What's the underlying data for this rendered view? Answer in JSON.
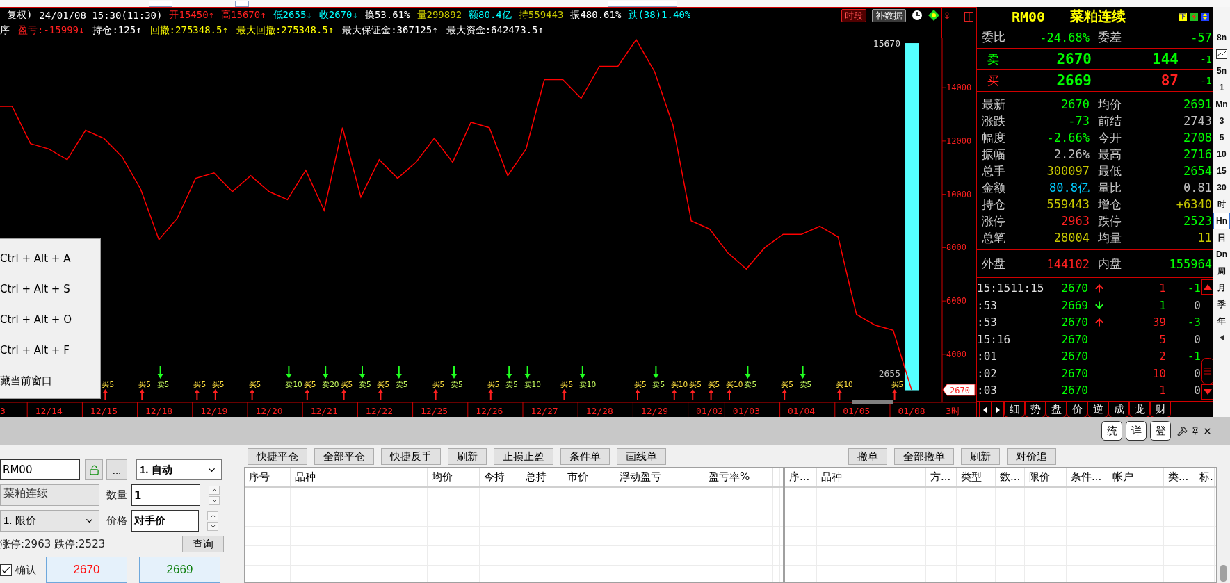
{
  "chart_header": {
    "line1": [
      {
        "text": "复权)",
        "color": "#ffffff"
      },
      {
        "text": "24/01/08 15:30(11:30)",
        "color": "#ffffff"
      },
      {
        "text": "开15450↑",
        "color": "#ff2020"
      },
      {
        "text": "高15670↑",
        "color": "#ff2020"
      },
      {
        "text": "低2655↓",
        "color": "#00ffff"
      },
      {
        "text": "收2670↓",
        "color": "#00ffff"
      },
      {
        "text": "换53.61%",
        "color": "#ffffff"
      },
      {
        "text": "量299892",
        "color": "#c8c800"
      },
      {
        "text": "额80.4亿",
        "color": "#00ffff"
      },
      {
        "text": "持559443",
        "color": "#c8c800"
      },
      {
        "text": "振480.61%",
        "color": "#ffffff"
      },
      {
        "text": "跌(38)1.40%",
        "color": "#00ffff"
      }
    ],
    "line2": [
      {
        "text": "序",
        "color": "#ffffff"
      },
      {
        "text": "盈亏:-15999↓",
        "color": "#ff2020"
      },
      {
        "text": "持仓:125↑",
        "color": "#ffffff"
      },
      {
        "text": "回撤:275348.5↑",
        "color": "#ffff00"
      },
      {
        "text": "最大回撤:275348.5↑",
        "color": "#ffff00"
      },
      {
        "text": "最大保证金:367125↑",
        "color": "#ffffff"
      },
      {
        "text": "最大资金:642473.5↑",
        "color": "#ffffff"
      }
    ],
    "buttons": [
      {
        "label": "时段",
        "kind": "alert"
      },
      {
        "label": "补数据",
        "kind": "plain"
      }
    ]
  },
  "chart": {
    "edge_label": "3",
    "period_label": "3时",
    "candle": {
      "high_label": "15670",
      "low_label": "2655"
    },
    "price_tag": "2670",
    "signals": [
      {
        "kind": "none"
      },
      {
        "kind": "none"
      },
      {
        "kind": "none"
      },
      {
        "kind": "none"
      },
      {
        "kind": "none"
      },
      {
        "kind": "none"
      },
      {
        "kind": "buy",
        "label": "买5"
      },
      {
        "kind": "none"
      },
      {
        "kind": "buy",
        "label": "买5"
      },
      {
        "kind": "sell",
        "label": "卖5"
      },
      {
        "kind": "none"
      },
      {
        "kind": "buy",
        "label": "买5"
      },
      {
        "kind": "buy",
        "label": "买5"
      },
      {
        "kind": "none"
      },
      {
        "kind": "buy",
        "label": "买5"
      },
      {
        "kind": "none"
      },
      {
        "kind": "sell",
        "label": "卖10"
      },
      {
        "kind": "buy",
        "label": "买5"
      },
      {
        "kind": "sell",
        "label": "卖20"
      },
      {
        "kind": "buy",
        "label": "买5"
      },
      {
        "kind": "sell",
        "label": "卖5"
      },
      {
        "kind": "buy",
        "label": "买5"
      },
      {
        "kind": "sell",
        "label": "卖5"
      },
      {
        "kind": "none"
      },
      {
        "kind": "buy",
        "label": "买5"
      },
      {
        "kind": "sell",
        "label": "卖5"
      },
      {
        "kind": "none"
      },
      {
        "kind": "buy",
        "label": "买5"
      },
      {
        "kind": "sell",
        "label": "卖5"
      },
      {
        "kind": "sell",
        "label": "卖10"
      },
      {
        "kind": "none"
      },
      {
        "kind": "buy",
        "label": "买5"
      },
      {
        "kind": "sell",
        "label": "卖10"
      },
      {
        "kind": "none"
      },
      {
        "kind": "none"
      },
      {
        "kind": "buy",
        "label": "买5"
      },
      {
        "kind": "sell",
        "label": "卖5"
      },
      {
        "kind": "buy",
        "label": "买10"
      },
      {
        "kind": "buy",
        "label": "买5"
      },
      {
        "kind": "buy",
        "label": "买5"
      },
      {
        "kind": "buy",
        "label": "买10"
      },
      {
        "kind": "sell",
        "label": "卖5"
      },
      {
        "kind": "none"
      },
      {
        "kind": "buy",
        "label": "买5"
      },
      {
        "kind": "sell",
        "label": "卖5"
      },
      {
        "kind": "none"
      },
      {
        "kind": "buy",
        "label": "买10"
      },
      {
        "kind": "none"
      },
      {
        "kind": "none"
      },
      {
        "kind": "buy",
        "label": "买5"
      }
    ],
    "chart_data": {
      "type": "line",
      "categories": [
        null,
        null,
        null,
        "12/14",
        null,
        null,
        "12/15",
        null,
        null,
        "12/18",
        null,
        null,
        "12/19",
        null,
        null,
        "12/20",
        null,
        null,
        "12/21",
        null,
        null,
        "12/22",
        null,
        null,
        "12/25",
        null,
        null,
        "12/26",
        null,
        null,
        "12/27",
        null,
        null,
        "12/28",
        null,
        null,
        "12/29",
        null,
        null,
        "01/02",
        null,
        "01/03",
        null,
        null,
        "01/04",
        null,
        null,
        "01/05",
        null,
        null,
        "01/08"
      ],
      "series": [
        {
          "color": "#ff0000",
          "values": [
            13300,
            13300,
            11900,
            11700,
            11300,
            12400,
            12100,
            11400,
            10200,
            8300,
            9100,
            10600,
            10800,
            10100,
            10700,
            10100,
            9800,
            10900,
            9400,
            12500,
            9900,
            11300,
            10600,
            11200,
            12100,
            11200,
            12700,
            12500,
            10700,
            11700,
            14300,
            14300,
            13600,
            14800,
            14800,
            15800,
            14600,
            12600,
            9000,
            8700,
            7800,
            7200,
            8000,
            8500,
            8500,
            8800,
            8400,
            5500,
            5100,
            4900,
            2670
          ]
        }
      ],
      "ylim": [
        2200,
        17000
      ],
      "yticks": [
        4000,
        6000,
        8000,
        10000,
        12000,
        14000
      ]
    }
  },
  "context_menu": {
    "items": [
      "Ctrl + Alt + A",
      "Ctrl + Alt + S",
      "Ctrl + Alt + O",
      "Ctrl + Alt + F",
      "藏当前窗口"
    ]
  },
  "quote": {
    "code": "RM00",
    "name": "菜粕连续",
    "badge": "下",
    "ratio": [
      {
        "label": "委比",
        "value": "-24.68%",
        "color": "#00ff00"
      },
      {
        "label": "委差",
        "value": "-57",
        "color": "#00ff00"
      }
    ],
    "book": [
      {
        "cells": [
          {
            "text": "卖",
            "color": "#00ff00"
          },
          {
            "text": "2670",
            "color": "#00ff00"
          },
          {
            "text": "144",
            "color": "#00ff00"
          },
          {
            "text": "-1",
            "color": "#00ff00"
          }
        ]
      },
      {
        "cells": [
          {
            "text": "买",
            "color": "#ff2020"
          },
          {
            "text": "2669",
            "color": "#00ff00"
          },
          {
            "text": "87",
            "color": "#ff2020"
          },
          {
            "text": "-1",
            "color": "#00ff00"
          }
        ]
      }
    ],
    "stats": [
      {
        "label": "最新",
        "value": "2670",
        "color": "#00ff00"
      },
      {
        "label": "均价",
        "value": "2691",
        "color": "#00ff00"
      },
      {
        "label": "涨跌",
        "value": "-73",
        "color": "#00ff00"
      },
      {
        "label": "前结",
        "value": "2743",
        "color": "#c0c0c0"
      },
      {
        "label": "幅度",
        "value": "-2.66%",
        "color": "#00ff00"
      },
      {
        "label": "今开",
        "value": "2708",
        "color": "#00ff00"
      },
      {
        "label": "振幅",
        "value": "2.26%",
        "color": "#c0c0c0"
      },
      {
        "label": "最高",
        "value": "2716",
        "color": "#00ff00"
      },
      {
        "label": "总手",
        "value": "300097",
        "color": "#c8c800"
      },
      {
        "label": "最低",
        "value": "2654",
        "color": "#00ff00"
      },
      {
        "label": "金额",
        "value": "80.8亿",
        "color": "#00ccff"
      },
      {
        "label": "量比",
        "value": "0.81",
        "color": "#c0c0c0"
      },
      {
        "label": "持仓",
        "value": "559443",
        "color": "#c8c800"
      },
      {
        "label": "增仓",
        "value": "+6340",
        "color": "#c8c800"
      },
      {
        "label": "涨停",
        "value": "2963",
        "color": "#ff2020"
      },
      {
        "label": "跌停",
        "value": "2523",
        "color": "#00ff00"
      },
      {
        "label": "总笔",
        "value": "28004",
        "color": "#c8c800"
      },
      {
        "label": "均量",
        "value": "11",
        "color": "#c8c800"
      }
    ],
    "flow": [
      {
        "label": "外盘",
        "value": "144102",
        "color": "#ff2020"
      },
      {
        "label": "内盘",
        "value": "155964",
        "color": "#00ff00"
      }
    ],
    "ticks": [
      {
        "time": "15:1511:15",
        "price": "2670",
        "kind": "up",
        "volume": {
          "text": "1",
          "color": "#ff2020"
        },
        "change": {
          "text": "-1",
          "color": "#00ff00"
        },
        "divider": false
      },
      {
        "time": ":53",
        "price": "2669",
        "kind": "down",
        "volume": {
          "text": "1",
          "color": "#00ff00"
        },
        "change": {
          "text": "0",
          "color": "#c0c0c0"
        },
        "divider": false
      },
      {
        "time": ":53",
        "price": "2670",
        "kind": "up",
        "volume": {
          "text": "39",
          "color": "#ff2020"
        },
        "change": {
          "text": "-3",
          "color": "#00ff00"
        },
        "divider": false
      },
      {
        "time": "15:16",
        "price": "2670",
        "kind": "none",
        "volume": {
          "text": "5",
          "color": "#ff2020"
        },
        "change": {
          "text": "0",
          "color": "#c0c0c0"
        },
        "divider": true
      },
      {
        "time": ":01",
        "price": "2670",
        "kind": "none",
        "volume": {
          "text": "2",
          "color": "#ff2020"
        },
        "change": {
          "text": "-1",
          "color": "#00ff00"
        },
        "divider": false
      },
      {
        "time": ":02",
        "price": "2670",
        "kind": "none",
        "volume": {
          "text": "10",
          "color": "#ff2020"
        },
        "change": {
          "text": "0",
          "color": "#c0c0c0"
        },
        "divider": false
      },
      {
        "time": ":03",
        "price": "2670",
        "kind": "none",
        "volume": {
          "text": "1",
          "color": "#ff2020"
        },
        "change": {
          "text": "0",
          "color": "#c0c0c0"
        },
        "divider": false
      }
    ],
    "tabs": [
      "细",
      "势",
      "盘",
      "价",
      "逆",
      "成",
      "龙",
      "财"
    ]
  },
  "periods": [
    {
      "kind": "text",
      "label": "8n",
      "selected": false
    },
    {
      "kind": "icon",
      "selected": false
    },
    {
      "kind": "text",
      "label": "5n",
      "selected": false
    },
    {
      "kind": "text",
      "label": "1",
      "selected": false
    },
    {
      "kind": "text",
      "label": "Mn",
      "selected": false
    },
    {
      "kind": "text",
      "label": "3",
      "selected": false
    },
    {
      "kind": "text",
      "label": "5",
      "selected": false
    },
    {
      "kind": "text",
      "label": "10",
      "selected": false
    },
    {
      "kind": "text",
      "label": "15",
      "selected": false
    },
    {
      "kind": "text",
      "label": "30",
      "selected": false
    },
    {
      "kind": "text",
      "label": "时",
      "selected": false
    },
    {
      "kind": "text",
      "label": "Hn",
      "selected": true
    },
    {
      "kind": "text",
      "label": "日",
      "selected": false
    },
    {
      "kind": "text",
      "label": "Dn",
      "selected": false
    },
    {
      "kind": "text",
      "label": "周",
      "selected": false
    },
    {
      "kind": "text",
      "label": "月",
      "selected": false
    },
    {
      "kind": "text",
      "label": "季",
      "selected": false
    },
    {
      "kind": "text",
      "label": "年",
      "selected": false
    },
    {
      "kind": "arrow",
      "selected": false
    }
  ],
  "band_buttons": [
    "统",
    "详",
    "登"
  ],
  "order_form": {
    "symbol": "RM00",
    "more": "...",
    "mode": "1. 自动",
    "name": "菜粕连续",
    "qty_label": "数量",
    "qty": "1",
    "type": "1. 限价",
    "price_label": "价格",
    "price": "对手价",
    "limits": "涨停:2963 跌停:2523",
    "query": "查询",
    "confirm": {
      "label": "确认",
      "checked": true
    },
    "sell_price": "2670",
    "buy_price": "2669"
  },
  "positions": {
    "buttons": [
      "快捷平仓",
      "全部平仓",
      "快捷反手",
      "刷新",
      "止损止盈",
      "条件单",
      "画线单"
    ],
    "columns": [
      "序号",
      "品种",
      "均价",
      "今持",
      "总持",
      "市价",
      "浮动盈亏",
      "盈亏率%"
    ]
  },
  "orders": {
    "buttons": [
      "撤单",
      "全部撤单",
      "刷新",
      "对价追"
    ],
    "columns": [
      "序...",
      "品种",
      "方...",
      "类型",
      "数...",
      "限价",
      "条件...",
      "帐户",
      "类...",
      "标."
    ]
  }
}
